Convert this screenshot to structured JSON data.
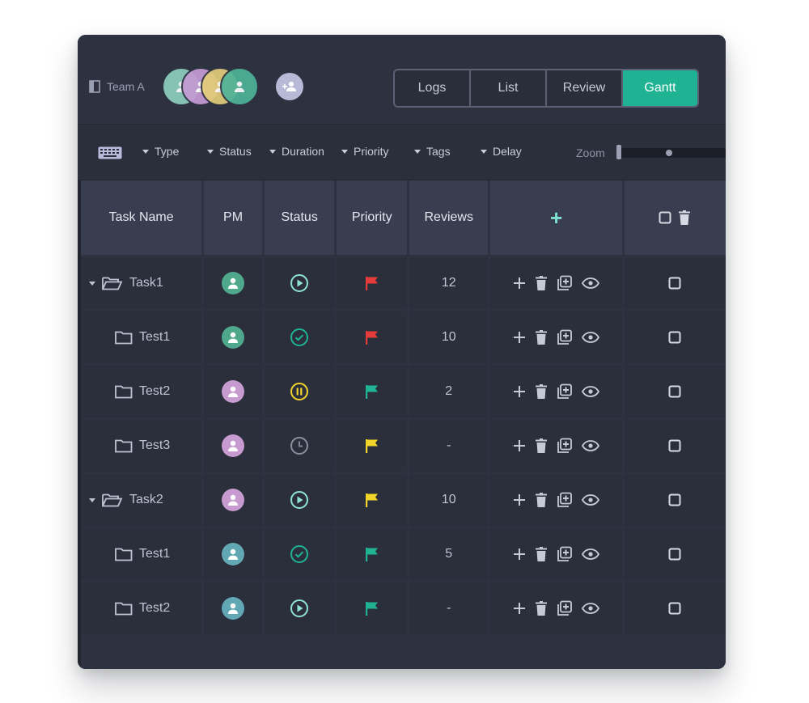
{
  "team": {
    "name": "Team A"
  },
  "members": [
    {
      "icon": "user-icon",
      "color": "#8fcfbe"
    },
    {
      "icon": "user-icon",
      "color": "#c59bd4"
    },
    {
      "icon": "user-icon",
      "color": "#e3cd7a"
    },
    {
      "icon": "user-icon",
      "color": "#4fb39a"
    }
  ],
  "add_member_icon": "add-user-icon",
  "view_tabs": [
    {
      "label": "Logs",
      "active": false
    },
    {
      "label": "List",
      "active": false
    },
    {
      "label": "Review",
      "active": false
    },
    {
      "label": "Gantt",
      "active": true
    }
  ],
  "filters": [
    "Type",
    "Status",
    "Duration",
    "Priority",
    "Tags",
    "Delay"
  ],
  "zoom": {
    "label": "Zoom",
    "level": 0.45
  },
  "columns": [
    "Task Name",
    "PM",
    "Status",
    "Priority",
    "Reviews",
    "+",
    ""
  ],
  "rows": [
    {
      "name": "Task1",
      "level": 0,
      "expanded": true,
      "pm_color": "#4fa88c",
      "status": "play-icon",
      "status_color": "#8fe3d4",
      "priority_color": "#e53a3a",
      "reviews": "12"
    },
    {
      "name": "Test1",
      "level": 1,
      "pm_color": "#4fa88c",
      "status": "check-icon",
      "status_color": "#1fb394",
      "priority_color": "#e53a3a",
      "reviews": "10"
    },
    {
      "name": "Test2",
      "level": 1,
      "pm_color": "#c79bd0",
      "status": "pause-icon",
      "status_color": "#f2d52a",
      "priority_color": "#1fb394",
      "reviews": "2"
    },
    {
      "name": "Test3",
      "level": 1,
      "pm_color": "#c79bd0",
      "status": "clock-icon",
      "status_color": "#8a8f9e",
      "priority_color": "#f2d52a",
      "reviews": "-"
    },
    {
      "name": "Task2",
      "level": 0,
      "expanded": true,
      "pm_color": "#c79bd0",
      "status": "play-icon",
      "status_color": "#8fe3d4",
      "priority_color": "#f2d52a",
      "reviews": "10"
    },
    {
      "name": "Test1",
      "level": 1,
      "pm_color": "#62a8b4",
      "status": "check-icon",
      "status_color": "#1fb394",
      "priority_color": "#1fb394",
      "reviews": "5"
    },
    {
      "name": "Test2",
      "level": 1,
      "pm_color": "#62a8b4",
      "status": "play-icon",
      "status_color": "#8fe3d4",
      "priority_color": "#1fb394",
      "reviews": "-"
    }
  ],
  "colors": {
    "accent": "#1fb394",
    "panel": "#2e3240",
    "header_cell": "#383d50",
    "cell": "#2b2f3c"
  }
}
